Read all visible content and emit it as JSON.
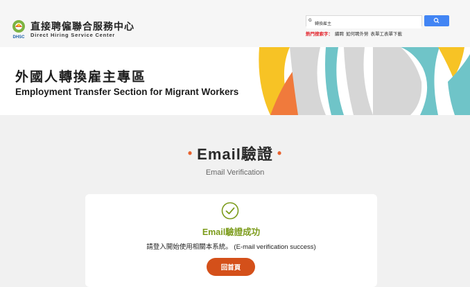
{
  "header": {
    "title_zh": "直接聘僱聯合服務中心",
    "title_en": "Direct Hiring Service Center",
    "logo_text": "DHSC",
    "search": {
      "brand": "Google",
      "value": "轉換雇主",
      "button_icon": "search-icon"
    },
    "hot_keywords": {
      "label": "熱門搜索字：",
      "items": [
        "續聘",
        "如何聘外勞",
        "表單工表單下載"
      ]
    }
  },
  "banner": {
    "title_zh": "外國人轉換雇主專區",
    "title_en": "Employment Transfer Section for Migrant Workers"
  },
  "main": {
    "heading_dot": "•",
    "heading": "Email驗證",
    "subheading": "Email Verification",
    "card": {
      "icon": "check-circle-icon",
      "title": "Email驗證成功",
      "message": "請登入開始使用相關本系統。 (E-mail verification success)",
      "button_label": "回首頁"
    }
  },
  "colors": {
    "accent_orange": "#e8622e",
    "button_orange": "#d4501a",
    "success_green": "#7b9b1a",
    "search_blue": "#4285f4",
    "banner_yellow": "#f7c325",
    "banner_teal": "#6fc4c8",
    "banner_gray": "#d6d6d6",
    "banner_coral": "#f07a3c"
  }
}
